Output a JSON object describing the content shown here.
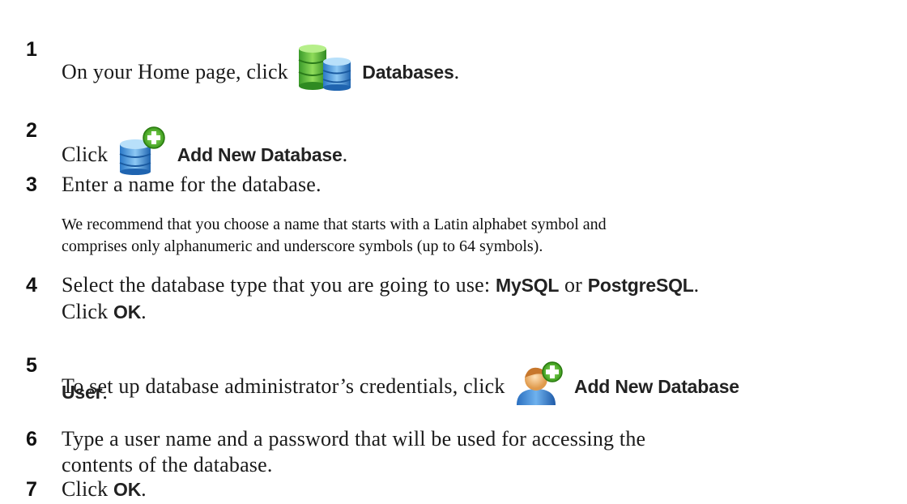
{
  "steps": [
    {
      "num": "1",
      "pre": "On your Home page, click",
      "ui": "Databases",
      "post": "."
    },
    {
      "num": "2",
      "pre": "Click",
      "ui": "Add New Database",
      "post": "."
    },
    {
      "num": "3",
      "text": "Enter a name for the database."
    },
    {
      "num": "4",
      "pre": "Select the database type that you are going to use:",
      "opt1": "MySQL",
      "or": "or",
      "opt2": "PostgreSQL",
      "post": ".",
      "line2_pre": "Click",
      "line2_ui": "OK",
      "line2_post": "."
    },
    {
      "num": "5",
      "pre": "To set up database administrator’s credentials, click",
      "ui": "Add New Database",
      "ui2": "User",
      "post": "."
    },
    {
      "num": "6",
      "line1": "Type a user name and a password that will be used for accessing the",
      "line2": "contents of the database."
    },
    {
      "num": "7",
      "pre": "Click",
      "ui": "OK",
      "post": "."
    }
  ],
  "note": {
    "line1": "We recommend that you choose a name that starts with a Latin alphabet symbol and",
    "line2": "comprises only alphanumeric and underscore symbols (up to 64 symbols)."
  },
  "icons": {
    "databases": "databases-icon",
    "add_database": "add-database-icon",
    "add_user": "add-database-user-icon"
  }
}
